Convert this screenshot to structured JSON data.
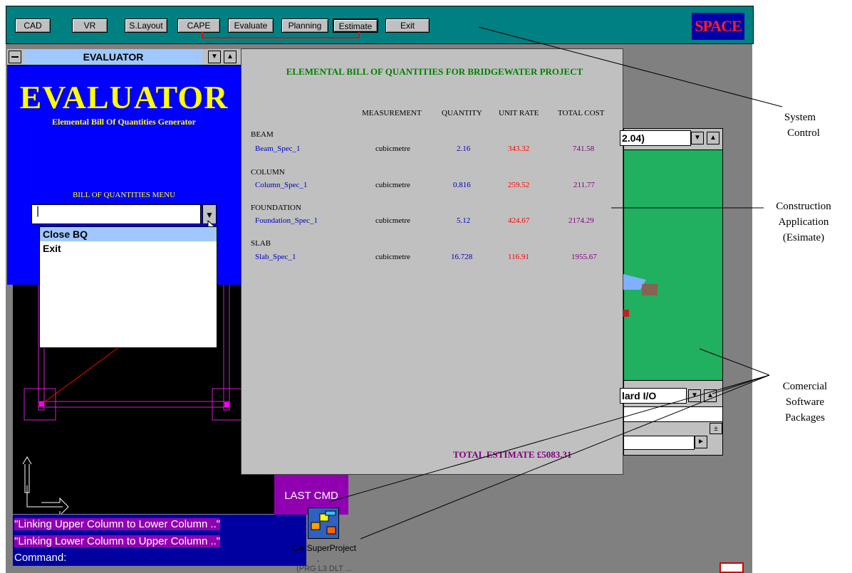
{
  "toolbar": {
    "buttons": [
      {
        "label": "CAD"
      },
      {
        "label": "VR"
      },
      {
        "label": "S.Layout"
      },
      {
        "label": "CAPE"
      },
      {
        "label": "Evaluate"
      },
      {
        "label": "Planning"
      },
      {
        "label": "Estimate"
      },
      {
        "label": "Exit"
      }
    ],
    "logo": "SPACE"
  },
  "evaluator": {
    "title": "EVALUATOR",
    "heading": "EVALUATOR",
    "subtitle": "Elemental Bill Of Quantities Generator",
    "menu_label": "BILL OF QUANTITIES MENU",
    "dropdown_value": "|",
    "items": [
      "Close BQ",
      "Exit"
    ]
  },
  "estimate": {
    "title": "ELEMENTAL BILL OF QUANTITIES FOR BRIDGEWATER PROJECT",
    "columns": {
      "measurement": "MEASUREMENT",
      "quantity": "QUANTITY",
      "unit_rate": "UNIT RATE",
      "total_cost": "TOTAL COST"
    },
    "rows": [
      {
        "category": "BEAM",
        "spec": "Beam_Spec_1",
        "measurement": "cubicmetre",
        "quantity": "2.16",
        "unit_rate": "343.32",
        "total_cost": "741.58"
      },
      {
        "category": "COLUMN",
        "spec": "Column_Spec_1",
        "measurement": "cubicmetre",
        "quantity": "0.816",
        "unit_rate": "259.52",
        "total_cost": "211.77"
      },
      {
        "category": "FOUNDATION",
        "spec": "Foundation_Spec_1",
        "measurement": "cubicmetre",
        "quantity": "5.12",
        "unit_rate": "424.67",
        "total_cost": "2174.29"
      },
      {
        "category": "SLAB",
        "spec": "Slab_Spec_1",
        "measurement": "cubicmetre",
        "quantity": "16.728",
        "unit_rate": "116.91",
        "total_cost": "1955.67"
      }
    ],
    "total": "TOTAL ESTIMATE £5083.31"
  },
  "commercial": {
    "combo_value": "2.04)",
    "io_value": "lard I/O"
  },
  "command": {
    "last_cmd": "LAST CMD",
    "lines": [
      "\"Linking Upper Column to Lower Column ..\"",
      "\"Linking Lower Column to Upper Column ..\"",
      "Command:"
    ]
  },
  "taskbar_app": {
    "label": "CA-SuperProject",
    "dot": ".",
    "sub": "(PRG L3 DLT ..."
  },
  "annotations": {
    "system_control": [
      "System",
      "Control"
    ],
    "construction_app": [
      "Construction",
      "Application",
      "(Esimate)"
    ],
    "commercial": [
      "Comercial",
      "Software",
      "Packages"
    ]
  },
  "colors": {
    "teal_bar": "#008080",
    "evaluator_blue": "#0000ff",
    "estimate_green_title": "#008000",
    "unit_rate_red": "#ff0000",
    "total_purple": "#800080",
    "cmd_purple": "#9000b0"
  }
}
